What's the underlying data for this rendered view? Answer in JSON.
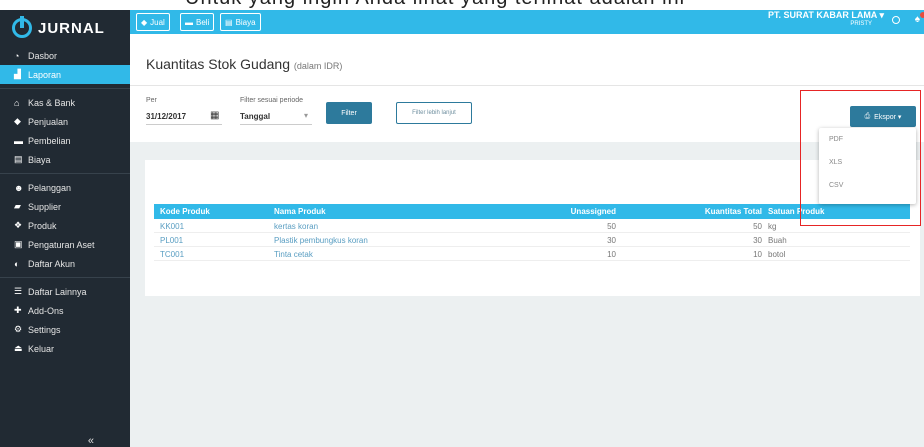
{
  "banner_text": "Untuk yang ingin Anda lihat yang terlihat adalah ini",
  "app": {
    "brand": "JURNAL"
  },
  "sidebar": {
    "items": [
      {
        "label": "Dasbor",
        "icon": "dashboard-icon",
        "active": false
      },
      {
        "label": "Laporan",
        "icon": "chart-icon",
        "active": true
      },
      {
        "label": "Kas & Bank",
        "icon": "bank-icon",
        "active": false
      },
      {
        "label": "Penjualan",
        "icon": "tag-icon",
        "active": false
      },
      {
        "label": "Pembelian",
        "icon": "card-icon",
        "active": false
      },
      {
        "label": "Biaya",
        "icon": "receipt-icon",
        "active": false
      },
      {
        "label": "Pelanggan",
        "icon": "users-icon",
        "active": false
      },
      {
        "label": "Supplier",
        "icon": "truck-icon",
        "active": false
      },
      {
        "label": "Produk",
        "icon": "box-icon",
        "active": false
      },
      {
        "label": "Pengaturan Aset",
        "icon": "asset-icon",
        "active": false
      },
      {
        "label": "Daftar Akun",
        "icon": "account-icon",
        "active": false
      },
      {
        "label": "Daftar Lainnya",
        "icon": "list-icon",
        "active": false
      },
      {
        "label": "Add-Ons",
        "icon": "puzzle-icon",
        "active": false
      },
      {
        "label": "Settings",
        "icon": "gear-icon",
        "active": false
      },
      {
        "label": "Keluar",
        "icon": "logout-icon",
        "active": false
      }
    ],
    "collapse_label": "«"
  },
  "topbar": {
    "jual": "Jual",
    "beli": "Beli",
    "biaya": "Biaya",
    "company": "PT. SURAT KABAR LAMA ▾",
    "user": "PRISTY"
  },
  "page": {
    "title": "Kuantitas Stok Gudang",
    "subtitle": "(dalam IDR)"
  },
  "filter": {
    "per_label": "Per",
    "date_value": "31/12/2017",
    "period_label": "Filter sesuai periode",
    "period_value": "Tanggal",
    "filter_button": "Filter",
    "more_button": "Filter lebih lanjut",
    "export_button": "Ekspor ▾"
  },
  "export_menu": {
    "options": [
      "PDF",
      "XLS",
      "CSV"
    ]
  },
  "table": {
    "headers": [
      "Kode Produk",
      "Nama Produk",
      "Unassigned",
      "Kuantitas Total",
      "Satuan Produk"
    ],
    "rows": [
      [
        "KK001",
        "kertas koran",
        "50",
        "50",
        "kg"
      ],
      [
        "PL001",
        "Plastik pembungkus koran",
        "30",
        "30",
        "Buah"
      ],
      [
        "TC001",
        "Tinta cetak",
        "10",
        "10",
        "botol"
      ]
    ]
  },
  "colors": {
    "accent": "#31b9e8",
    "sidebar_bg": "#212a33",
    "button_dark": "#2d7a9c",
    "highlight": "#e62525"
  }
}
